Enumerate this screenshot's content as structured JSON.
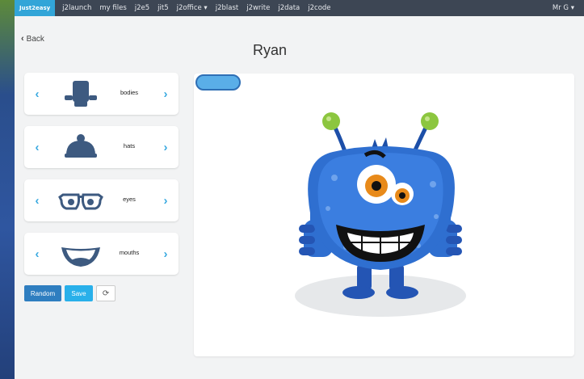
{
  "nav": {
    "brand": "Just2easy",
    "items": [
      "j2launch",
      "my files",
      "j2e5",
      "jit5",
      "j2office ▾",
      "j2blast",
      "j2write",
      "j2data",
      "j2code"
    ],
    "user": "Mr G ▾"
  },
  "back_label": "Back",
  "title": "Ryan",
  "parts": [
    {
      "label": "bodies",
      "icon": "body-silhouette-icon"
    },
    {
      "label": "hats",
      "icon": "hat-icon"
    },
    {
      "label": "eyes",
      "icon": "glasses-eyes-icon"
    },
    {
      "label": "mouths",
      "icon": "mouth-icon"
    }
  ],
  "buttons": {
    "random": "Random",
    "save": "Save",
    "refresh_icon": "refresh-icon"
  },
  "colors": {
    "nav_bg": "#3d4654",
    "brand_bg": "#32a5d8",
    "accent": "#39a9e0",
    "monster_body": "#2f6fd0",
    "antenna_ball": "#8cc63f"
  }
}
